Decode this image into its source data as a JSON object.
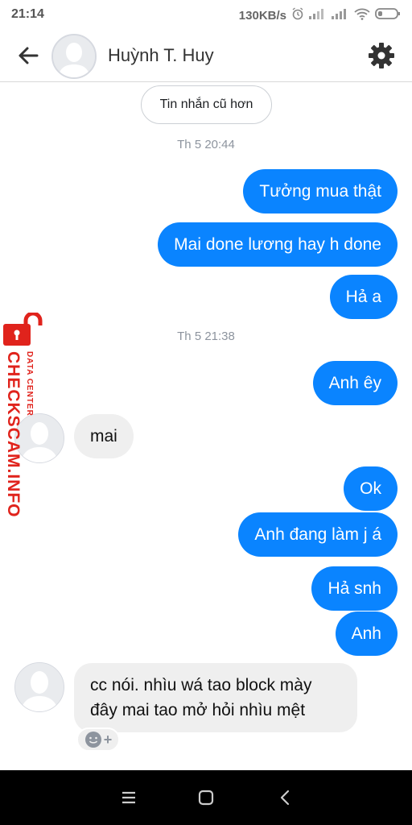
{
  "status_bar": {
    "time": "21:14",
    "speed": "130KB/s",
    "icons": [
      "alarm-icon",
      "signal-icon",
      "signal-icon",
      "wifi-icon",
      "battery-icon"
    ]
  },
  "header": {
    "contact_name": "Huỳnh T. Huy",
    "back_icon": "back-arrow-icon",
    "settings_icon": "gear-icon"
  },
  "chat": {
    "older_messages_label": "Tin nhắn cũ hơn",
    "timestamps": [
      "Th 5 20:44",
      "Th 5 21:38"
    ],
    "messages": [
      {
        "dir": "out",
        "text": "Tưởng mua thật"
      },
      {
        "dir": "out",
        "text": "Mai done lương hay h done"
      },
      {
        "dir": "out",
        "text": "Hả a"
      },
      {
        "dir": "out",
        "text": "Anh êy"
      },
      {
        "dir": "in",
        "text": "mai"
      },
      {
        "dir": "out",
        "text": "Ok"
      },
      {
        "dir": "out",
        "text": "Anh đang làm j á"
      },
      {
        "dir": "out",
        "text": "Hả snh"
      },
      {
        "dir": "out",
        "text": "Anh"
      },
      {
        "dir": "in",
        "text": "cc nói. nhìu wá tao block mày đây mai tao mở hỏi nhìu mệt"
      }
    ],
    "reaction": {
      "icon": "smiley-icon",
      "plus": "+"
    }
  },
  "watermark": {
    "main": "CHECKSCAM.INFO",
    "sub": "DATA CENTER"
  },
  "colors": {
    "outgoing_bubble": "#0a84ff",
    "incoming_bubble": "#efefef",
    "watermark": "#e0231c"
  },
  "nav": {
    "icons": [
      "menu-icon",
      "home-square-icon",
      "back-chevron-icon"
    ]
  }
}
